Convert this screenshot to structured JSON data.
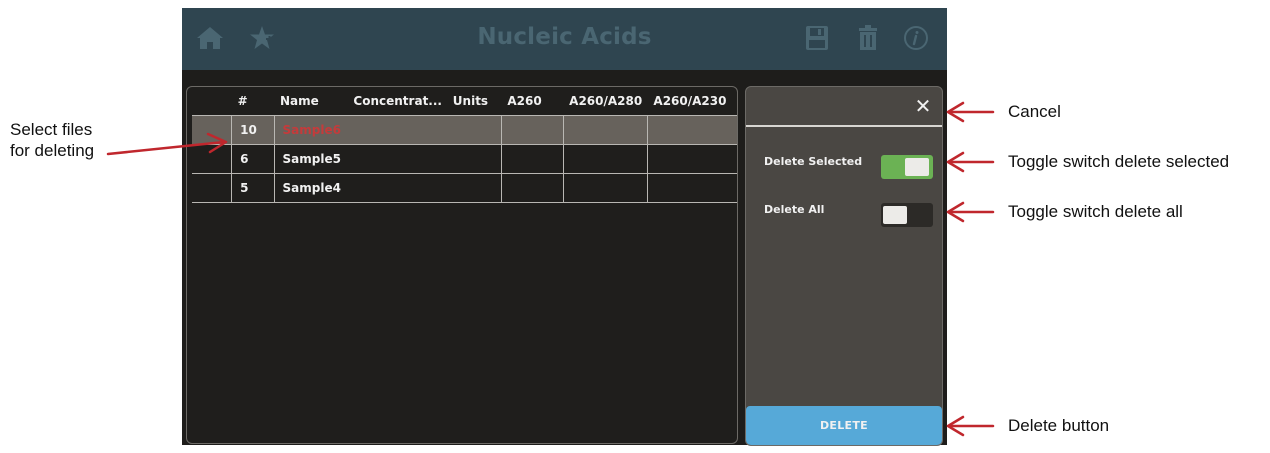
{
  "app": {
    "title": "Nucleic Acids"
  },
  "toolbar_icons": [
    "home-icon",
    "star-icon",
    "save-icon",
    "trash-icon",
    "info-icon"
  ],
  "table": {
    "columns": [
      "",
      "#",
      "Name",
      "Concentrat...",
      "Units",
      "A260",
      "A260/A280",
      "A260/A230"
    ],
    "rows": [
      {
        "num": "10",
        "name": "Sample6",
        "selected": true
      },
      {
        "num": "6",
        "name": "Sample5",
        "selected": false
      },
      {
        "num": "5",
        "name": "Sample4",
        "selected": false
      }
    ]
  },
  "side_panel": {
    "delete_selected_label": "Delete Selected",
    "delete_selected_on": true,
    "delete_all_label": "Delete All",
    "delete_all_on": false,
    "delete_button_label": "DELETE"
  },
  "annotations": {
    "select_files_line1": "Select files",
    "select_files_line2": "for deleting",
    "cancel": "Cancel",
    "toggle_selected": "Toggle switch delete selected",
    "toggle_all": "Toggle switch delete all",
    "delete_button": "Delete button"
  },
  "colors": {
    "topbar": "#2f4550",
    "accent_green": "#6bb254",
    "delete_blue": "#56a9d8",
    "annotation_arrow": "#c0272d",
    "selected_name": "#c53b3b"
  }
}
